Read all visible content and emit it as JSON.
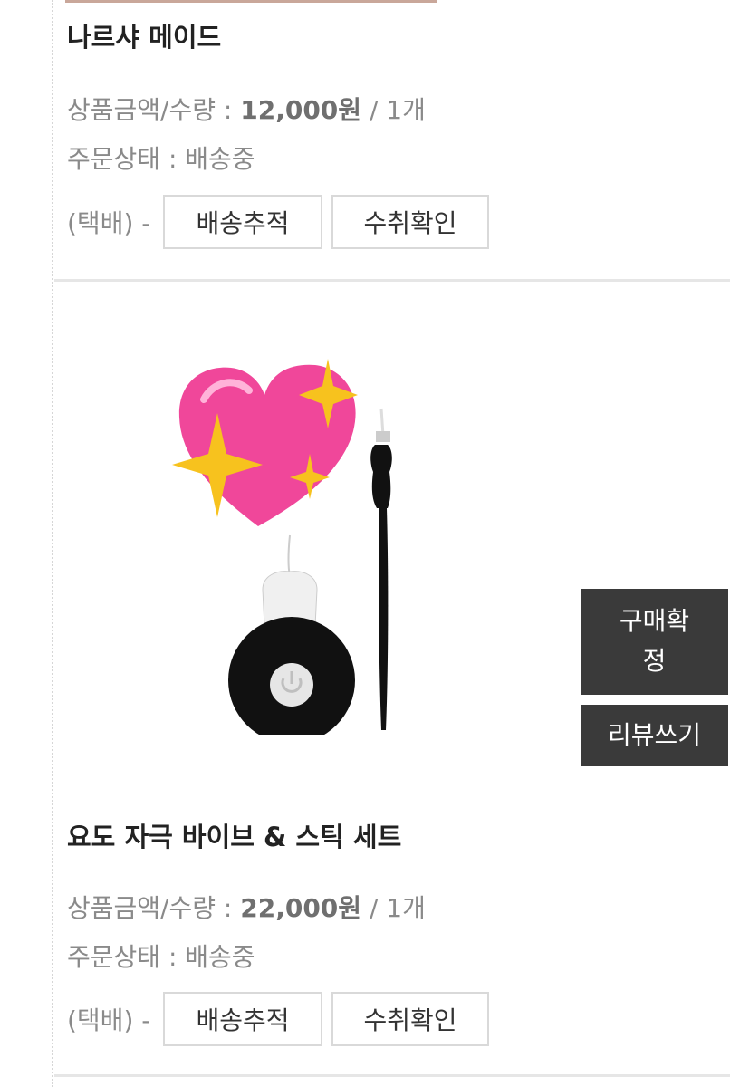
{
  "orders": [
    {
      "name": "나르샤 메이드",
      "amount_label": "상품금액/수량 : ",
      "price": "12,000원",
      "qty": " / 1개",
      "status_label": "주문상태 : ",
      "status": "배송중",
      "ship_method": "(택배) -",
      "track_button": "배송추적",
      "receipt_button": "수취확인"
    },
    {
      "name": "요도 자극 바이브 & 스틱 세트",
      "amount_label": "상품금액/수량 : ",
      "price": "22,000원",
      "qty": " / 1개",
      "status_label": "주문상태 : ",
      "status": "배송중",
      "ship_method": "(택배) -",
      "track_button": "배송추적",
      "receipt_button": "수취확인"
    }
  ],
  "side_actions": {
    "purchase_confirm_line1": "구매확",
    "purchase_confirm_line2": "정",
    "write_review": "리뷰쓰기"
  },
  "icons": [
    "sparkling-heart-icon",
    "power-icon"
  ],
  "colors": {
    "dark_button": "#3a3a3a",
    "heart_pink": "#f0479a",
    "sparkle_yellow": "#f7c21e"
  }
}
